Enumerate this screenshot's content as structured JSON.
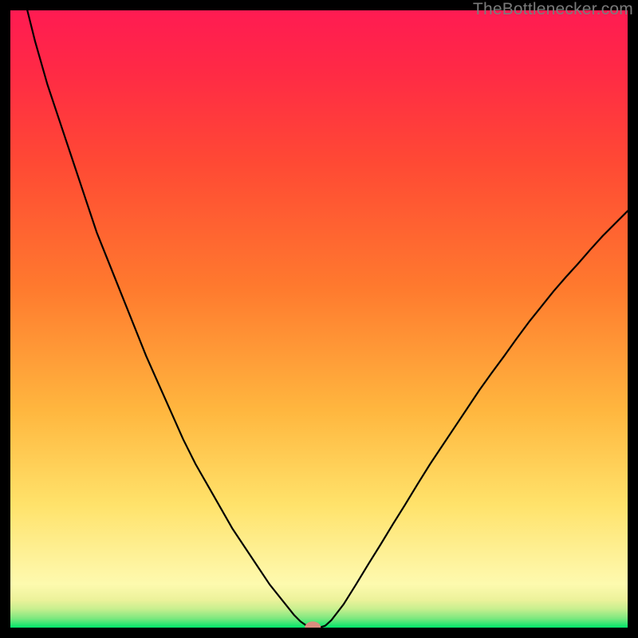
{
  "watermark": "TheBottlenecker.com",
  "chart_data": {
    "type": "line",
    "title": "",
    "xlabel": "",
    "ylabel": "",
    "xlim": [
      0,
      100
    ],
    "ylim": [
      0,
      100
    ],
    "background_gradient": {
      "stops": [
        {
          "pos": 0.0,
          "color": "#00e66a"
        },
        {
          "pos": 0.015,
          "color": "#7de87f"
        },
        {
          "pos": 0.03,
          "color": "#c6ef8f"
        },
        {
          "pos": 0.045,
          "color": "#ecf29a"
        },
        {
          "pos": 0.07,
          "color": "#fdfaae"
        },
        {
          "pos": 0.1,
          "color": "#fef4a0"
        },
        {
          "pos": 0.2,
          "color": "#ffe26a"
        },
        {
          "pos": 0.35,
          "color": "#ffb73f"
        },
        {
          "pos": 0.55,
          "color": "#ff7a2e"
        },
        {
          "pos": 0.75,
          "color": "#ff4a34"
        },
        {
          "pos": 0.9,
          "color": "#ff2a45"
        },
        {
          "pos": 1.0,
          "color": "#ff1b52"
        }
      ]
    },
    "marker": {
      "x": 49.0,
      "y": 0.0,
      "color": "#da8d7f",
      "rx": 1.3,
      "ry": 1.0
    },
    "series": [
      {
        "name": "bottleneck-curve",
        "x": [
          0,
          2,
          4,
          6,
          8,
          10,
          12,
          14,
          16,
          18,
          20,
          22,
          24,
          26,
          28,
          30,
          32,
          34,
          36,
          38,
          40,
          42,
          44,
          46,
          47,
          48,
          49,
          50,
          51,
          52,
          54,
          56,
          58,
          60,
          62,
          64,
          66,
          68,
          70,
          72,
          74,
          76,
          78,
          80,
          82,
          84,
          86,
          88,
          90,
          92,
          94,
          96,
          98,
          100
        ],
        "y": [
          113,
          103,
          95,
          88,
          82,
          76,
          70,
          64,
          59,
          54,
          49,
          44,
          39.5,
          35,
          30.5,
          26.5,
          23,
          19.5,
          16,
          13,
          10,
          7,
          4.5,
          2,
          1,
          0.3,
          0,
          0,
          0.3,
          1.2,
          3.8,
          7,
          10.3,
          13.5,
          16.8,
          20,
          23.3,
          26.5,
          29.5,
          32.5,
          35.5,
          38.5,
          41.3,
          44,
          46.8,
          49.5,
          52,
          54.5,
          56.8,
          59,
          61.3,
          63.5,
          65.5,
          67.5
        ]
      }
    ]
  }
}
